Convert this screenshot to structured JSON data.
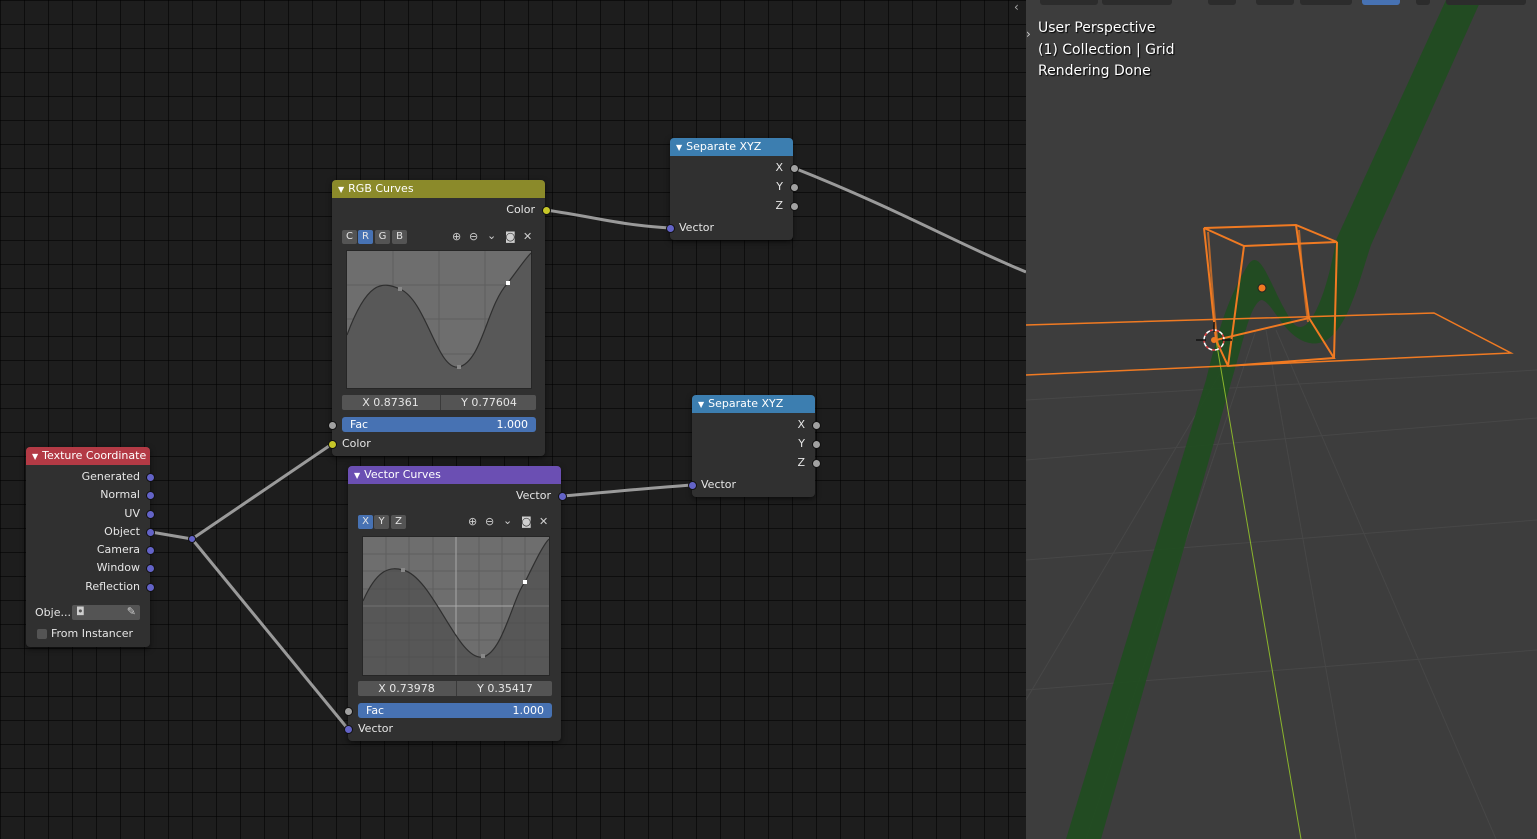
{
  "node_editor": {
    "rgb_curves": {
      "title": "RGB Curves",
      "output_label": "Color",
      "channels": [
        "C",
        "R",
        "G",
        "B"
      ],
      "active_channel": "R",
      "x_value": "X 0.87361",
      "y_value": "Y 0.77604",
      "fac_label": "Fac",
      "fac_value": "1.000",
      "input_label": "Color",
      "header_color": "#8b8a2a"
    },
    "vector_curves": {
      "title": "Vector Curves",
      "output_label": "Vector",
      "channels": [
        "X",
        "Y",
        "Z"
      ],
      "active_channel": "X",
      "x_value": "X 0.73978",
      "y_value": "Y 0.35417",
      "fac_label": "Fac",
      "fac_value": "1.000",
      "input_label": "Vector",
      "header_color": "#6b4fb3"
    },
    "separate_xyz_1": {
      "title": "Separate XYZ",
      "outputs": [
        "X",
        "Y",
        "Z"
      ],
      "input_label": "Vector",
      "header_color": "#3c7eb0"
    },
    "separate_xyz_2": {
      "title": "Separate XYZ",
      "outputs": [
        "X",
        "Y",
        "Z"
      ],
      "input_label": "Vector",
      "header_color": "#3c7eb0"
    },
    "texture_coordinate": {
      "title": "Texture Coordinate",
      "outputs": [
        "Generated",
        "Normal",
        "UV",
        "Object",
        "Camera",
        "Window",
        "Reflection"
      ],
      "object_label": "Obje...",
      "from_instancer_label": "From Instancer",
      "header_color": "#b33a45"
    }
  },
  "viewport": {
    "lines": [
      "User Perspective",
      "(1) Collection | Grid",
      "Rendering Done"
    ],
    "background_color": "#3d3d3d",
    "selection_color": "#f07a22",
    "y_axis_color": "#8ab52c"
  },
  "icons": {
    "expand_arrow": "chevron-right-icon",
    "zoom_in": "zoom-in-icon",
    "zoom_out": "zoom-out-icon",
    "dropdown": "chevron-down-icon",
    "clip": "dot-icon",
    "close": "x-icon",
    "eyedropper": "eyedropper-icon",
    "object": "object-icon"
  }
}
